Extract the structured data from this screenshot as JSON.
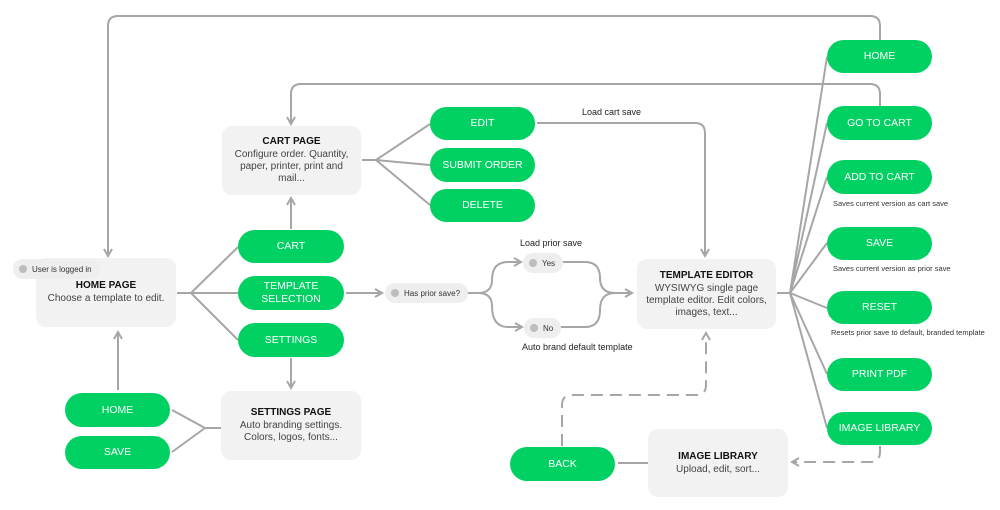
{
  "colors": {
    "accent": "#00d162",
    "node": "#f2f2f2",
    "connector": "#a6a6a6"
  },
  "nodes": {
    "home_page": {
      "title": "HOME PAGE",
      "desc": "Choose a template to edit.",
      "badge": "User is logged in"
    },
    "cart_page": {
      "title": "CART PAGE",
      "desc": "Configure order. Quantity, paper, printer, print and mail..."
    },
    "settings_page": {
      "title": "SETTINGS PAGE",
      "desc": "Auto branding settings. Colors, logos, fonts..."
    },
    "template_editor": {
      "title": "TEMPLATE EDITOR",
      "desc": "WYSIWYG single page template editor. Edit colors, images, text..."
    },
    "image_library": {
      "title": "IMAGE LIBRARY",
      "desc": "Upload, edit, sort..."
    }
  },
  "home_actions": [
    "CART",
    "TEMPLATE SELECTION",
    "SETTINGS"
  ],
  "cart_actions": [
    "EDIT",
    "SUBMIT ORDER",
    "DELETE"
  ],
  "settings_actions": [
    "HOME",
    "SAVE"
  ],
  "editor_actions": [
    {
      "label": "HOME",
      "caption": ""
    },
    {
      "label": "GO TO CART",
      "caption": ""
    },
    {
      "label": "ADD TO CART",
      "caption": "Saves current version as cart save"
    },
    {
      "label": "SAVE",
      "caption": "Saves current version as prior save"
    },
    {
      "label": "RESET",
      "caption": "Resets prior save to default, branded template"
    },
    {
      "label": "PRINT PDF",
      "caption": ""
    },
    {
      "label": "IMAGE LIBRARY",
      "caption": ""
    }
  ],
  "image_library_actions": [
    "BACK"
  ],
  "decision": {
    "question": "Has prior save?",
    "yes": "Yes",
    "no": "No",
    "yes_label": "Load prior save",
    "no_label": "Auto brand default template"
  },
  "edge_labels": {
    "edit_to_editor": "Load cart save"
  }
}
